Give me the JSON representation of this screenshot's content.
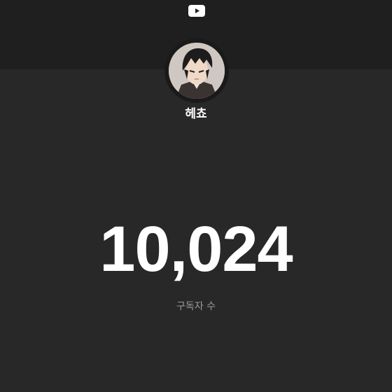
{
  "header": {
    "logo_icon": "youtube-play-icon"
  },
  "channel": {
    "avatar_icon": "channel-avatar",
    "name": "헤쵸"
  },
  "stats": {
    "subscriber_count": "10,024",
    "subscriber_label": "구독자 수"
  },
  "colors": {
    "background": "#282828",
    "header_band": "#1f1f1f",
    "text_primary": "#ffffff",
    "text_secondary": "#9a9a9a"
  }
}
